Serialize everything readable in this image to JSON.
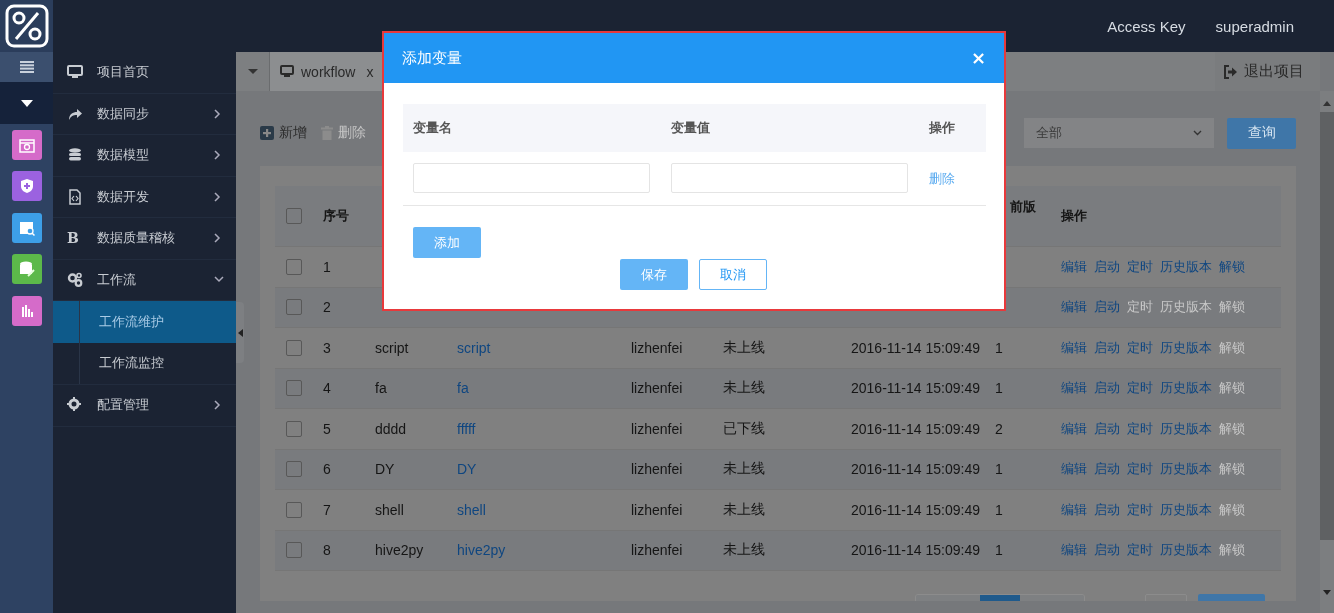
{
  "topbar": {
    "links": [
      "Access Key",
      "superadmin"
    ]
  },
  "rail": {
    "items": [
      {
        "kind": "menu",
        "selected": false
      },
      {
        "kind": "caret",
        "selected": true
      },
      {
        "kind": "calendar",
        "color": "#d56bc9",
        "selected": false
      },
      {
        "kind": "shield",
        "color": "#9b62e0",
        "selected": false
      },
      {
        "kind": "folder-search",
        "color": "#3d9fe8",
        "selected": false
      },
      {
        "kind": "db-edit",
        "color": "#5cb94a",
        "selected": false
      },
      {
        "kind": "chart",
        "color": "#d56bc9",
        "selected": false
      }
    ]
  },
  "sidebar": {
    "items": [
      {
        "label": "项目首页"
      },
      {
        "label": "数据同步",
        "expanded": false
      },
      {
        "label": "数据模型",
        "expanded": false
      },
      {
        "label": "数据开发",
        "expanded": false
      },
      {
        "label": "数据质量稽核",
        "glyph": "B",
        "expanded": false
      },
      {
        "label": "工作流",
        "expanded": true,
        "children": [
          {
            "label": "工作流维护",
            "selected": true
          },
          {
            "label": "工作流监控",
            "selected": false
          }
        ]
      },
      {
        "label": "配置管理",
        "expanded": false
      }
    ]
  },
  "tabs": [
    {
      "label": "workflow",
      "close": "x",
      "selected": true
    }
  ],
  "exit_project": "退出项目",
  "toolbar": {
    "buttons": [
      {
        "label": "新增",
        "kind": "add",
        "disabled": false
      },
      {
        "label": "删除",
        "kind": "delete",
        "disabled": true
      }
    ],
    "filter": {
      "value": "全部"
    },
    "query": "查询"
  },
  "table": {
    "header": {
      "checked": false,
      "index": "序号",
      "column_8": "前版",
      "actions": "操作"
    },
    "rows": [
      {
        "index": "1",
        "checked": false,
        "actions": [
          {
            "label": "编辑",
            "disabled": false
          },
          {
            "label": "启动",
            "disabled": false
          },
          {
            "label": "定时",
            "disabled": false
          },
          {
            "label": "历史版本",
            "disabled": false
          },
          {
            "label": "解锁",
            "disabled": false
          }
        ]
      },
      {
        "index": "2",
        "checked": false,
        "actions": [
          {
            "label": "编辑",
            "disabled": false
          },
          {
            "label": "启动",
            "disabled": false
          },
          {
            "label": "定时",
            "disabled": true
          },
          {
            "label": "历史版本",
            "disabled": true
          },
          {
            "label": "解锁",
            "disabled": true
          }
        ]
      },
      {
        "index": "3",
        "checked": false,
        "name": "script",
        "link": "script",
        "owner": "lizhenfei",
        "status": "未上线",
        "time": "2016-11-14 15:09:49",
        "version": "1",
        "actions": [
          {
            "label": "编辑",
            "disabled": false
          },
          {
            "label": "启动",
            "disabled": false
          },
          {
            "label": "定时",
            "disabled": false
          },
          {
            "label": "历史版本",
            "disabled": false
          },
          {
            "label": "解锁",
            "disabled": true
          }
        ]
      },
      {
        "index": "4",
        "checked": false,
        "name": "fa",
        "link": "fa",
        "owner": "lizhenfei",
        "status": "未上线",
        "time": "2016-11-14 15:09:49",
        "version": "1",
        "actions": [
          {
            "label": "编辑",
            "disabled": false
          },
          {
            "label": "启动",
            "disabled": false
          },
          {
            "label": "定时",
            "disabled": false
          },
          {
            "label": "历史版本",
            "disabled": false
          },
          {
            "label": "解锁",
            "disabled": true
          }
        ]
      },
      {
        "index": "5",
        "checked": false,
        "name": "dddd",
        "link": "fffff",
        "owner": "lizhenfei",
        "status": "已下线",
        "time": "2016-11-14 15:09:49",
        "version": "2",
        "actions": [
          {
            "label": "编辑",
            "disabled": false
          },
          {
            "label": "启动",
            "disabled": false
          },
          {
            "label": "定时",
            "disabled": false
          },
          {
            "label": "历史版本",
            "disabled": false
          },
          {
            "label": "解锁",
            "disabled": true
          }
        ]
      },
      {
        "index": "6",
        "checked": false,
        "name": "DY",
        "link": "DY",
        "owner": "lizhenfei",
        "status": "未上线",
        "time": "2016-11-14 15:09:49",
        "version": "1",
        "actions": [
          {
            "label": "编辑",
            "disabled": false
          },
          {
            "label": "启动",
            "disabled": false
          },
          {
            "label": "定时",
            "disabled": false
          },
          {
            "label": "历史版本",
            "disabled": false
          },
          {
            "label": "解锁",
            "disabled": true
          }
        ]
      },
      {
        "index": "7",
        "checked": false,
        "name": "shell",
        "link": "shell",
        "owner": "lizhenfei",
        "status": "未上线",
        "time": "2016-11-14 15:09:49",
        "version": "1",
        "actions": [
          {
            "label": "编辑",
            "disabled": false
          },
          {
            "label": "启动",
            "disabled": false
          },
          {
            "label": "定时",
            "disabled": false
          },
          {
            "label": "历史版本",
            "disabled": false
          },
          {
            "label": "解锁",
            "disabled": true
          }
        ]
      },
      {
        "index": "8",
        "checked": false,
        "name": "hive2py",
        "link": "hive2py",
        "owner": "lizhenfei",
        "status": "未上线",
        "time": "2016-11-14 15:09:49",
        "version": "1",
        "actions": [
          {
            "label": "编辑",
            "disabled": false
          },
          {
            "label": "启动",
            "disabled": false
          },
          {
            "label": "定时",
            "disabled": false
          },
          {
            "label": "历史版本",
            "disabled": false
          },
          {
            "label": "解锁",
            "disabled": true
          }
        ]
      }
    ]
  },
  "pagination": {
    "pages": [
      {
        "selected": false
      },
      {
        "selected": true
      },
      {
        "selected": false
      }
    ]
  },
  "modal": {
    "title": "添加变量",
    "close": "×",
    "columns": [
      "变量名",
      "变量值",
      "操作"
    ],
    "rows": [
      {
        "action": "删除"
      }
    ],
    "add_button": "添加",
    "buttons": [
      {
        "label": "保存",
        "kind": "primary"
      },
      {
        "label": "取消",
        "kind": "secondary"
      }
    ]
  }
}
